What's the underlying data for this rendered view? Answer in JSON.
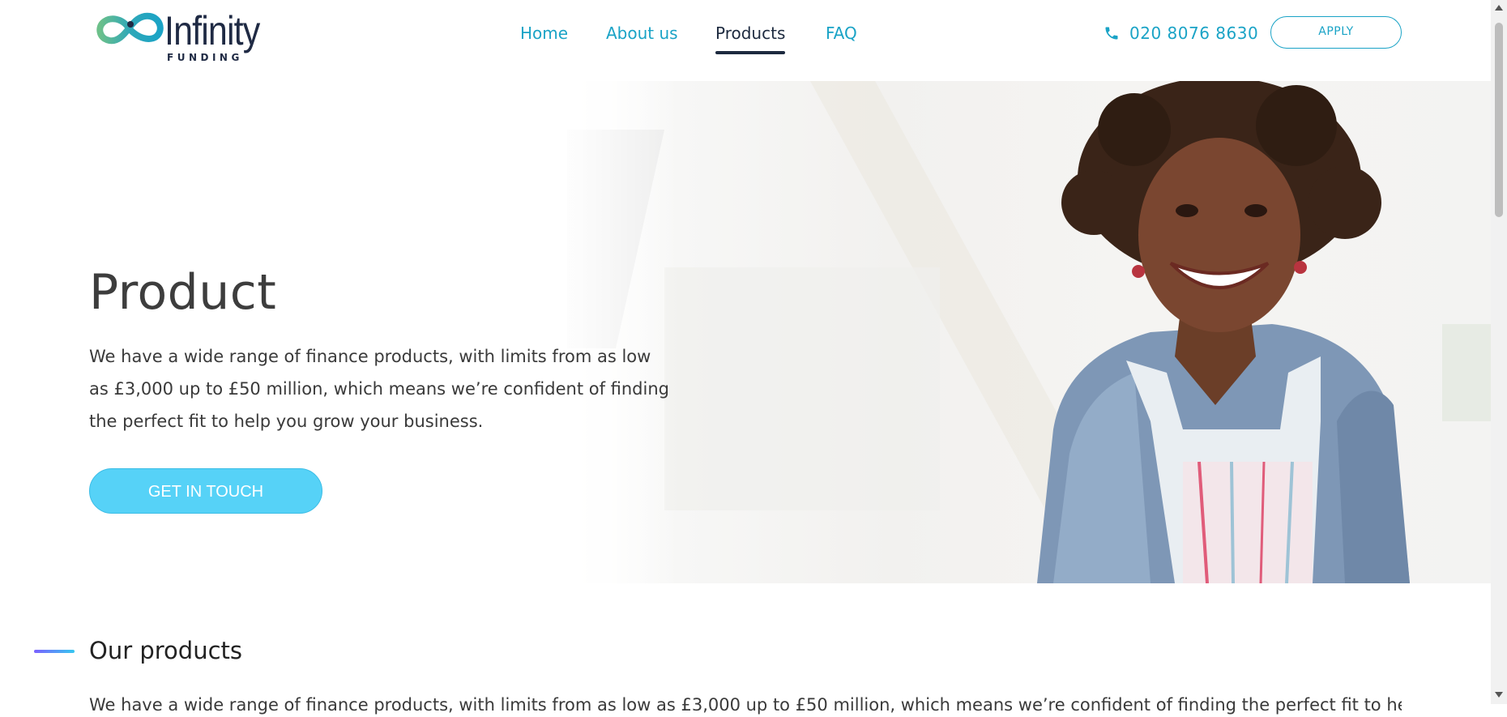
{
  "brand": {
    "name": "Infinity",
    "tagline": "FUNDING",
    "colors": {
      "navy": "#1f2a44",
      "teal": "#1aa3c6",
      "cta": "#56d2f7",
      "logo_green": "#6cc08a",
      "logo_blue": "#1aa3c6"
    }
  },
  "nav": {
    "items": [
      {
        "label": "Home",
        "active": false
      },
      {
        "label": "About us",
        "active": false
      },
      {
        "label": "Products",
        "active": true
      },
      {
        "label": "FAQ",
        "active": false
      }
    ]
  },
  "contact": {
    "phone": "020 8076 8630",
    "phone_icon": "phone-icon"
  },
  "apply_label": "APPLY",
  "hero": {
    "title": "Product",
    "text": "We have a wide range of finance products, with limits from as low as £3,000 up to £50 million, which means we’re confident of finding the perfect fit to help you grow your business.",
    "cta_label": "GET IN TOUCH"
  },
  "products_section": {
    "title": "Our products",
    "text": "We have a wide range of finance products, with limits from as low as £3,000 up to £50 million, which means we’re confident of finding the perfect fit to help you grow"
  }
}
